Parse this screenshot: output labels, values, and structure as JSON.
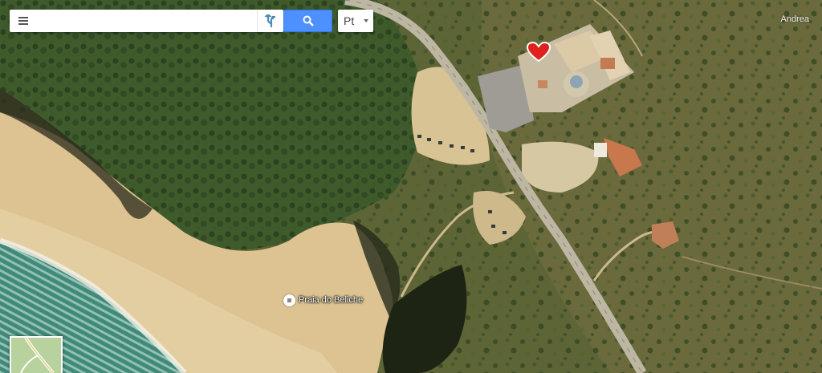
{
  "search": {
    "placeholder": "",
    "value": ""
  },
  "language": {
    "selected": "Pt"
  },
  "user": {
    "name": "Andrea"
  },
  "poi": {
    "label": "Praia do Beliche"
  },
  "colors": {
    "search_button": "#4d90fe",
    "favorite_marker": "#e0201c",
    "sea": "#3f8a78",
    "sand": "#ddc391",
    "vegetation": "#3c5428"
  },
  "icons": {
    "menu": "hamburger-menu-icon",
    "directions": "directions-icon",
    "search": "magnifier-icon",
    "poi": "beach-poi-icon",
    "favorite": "heart-icon"
  }
}
